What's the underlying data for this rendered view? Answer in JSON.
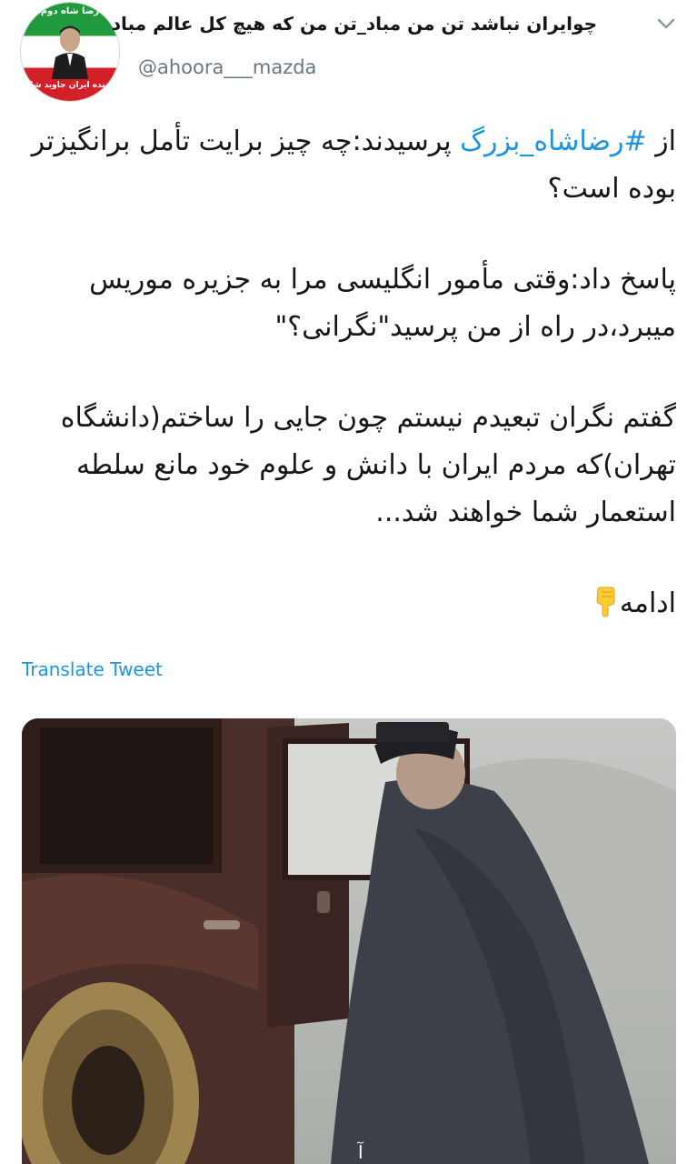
{
  "header": {
    "display_name": "چوایران نباشد تن من مباد_تن من که هیچ کل عالم مباد",
    "handle": "@ahoora___mazda",
    "avatar": {
      "ring_text_top": "رضا شاه دوم",
      "ring_text_bottom": "پاینده ایران جاوید شاه"
    },
    "menu_icon": "chevron-down-icon"
  },
  "body": {
    "p1_prefix": "از ",
    "p1_hashtag": "#رضاشاه_بزرگ",
    "p1_suffix": " پرسیدند:چه چیز برایت تأمل برانگیزتر بوده است؟",
    "p2": "پاسخ داد:وقتی مأمور انگلیسی مرا به جزیره موریس میبرد،در راه از من پرسید\"نگرانی؟\"",
    "p3": "گفتم نگران تبعیدم نیستم چون جایی را ساختم(دانشگاه تهران)که مردم ایران با دانش و علوم خود مانع سلطه استعمار شما خواهند شد...",
    "p4": "ادامه",
    "p4_emoji": "backhand-index-pointing-down-emoji"
  },
  "translate_label": "Translate Tweet",
  "media": {
    "caption_mark": "آ"
  },
  "colors": {
    "link": "#1b95e0",
    "handle": "#657786",
    "text": "#14171a"
  }
}
